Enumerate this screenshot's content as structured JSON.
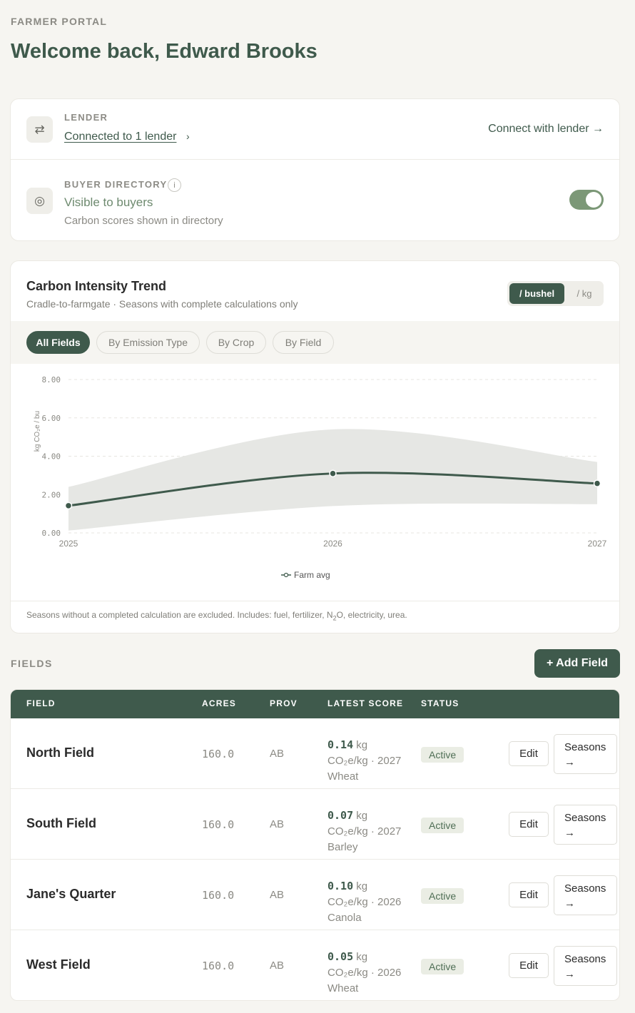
{
  "header": {
    "eyebrow": "FARMER PORTAL",
    "welcome": "Welcome back, Edward Brooks"
  },
  "lender": {
    "label": "LENDER",
    "link_text": "Connected to 1 lender",
    "chevron": "›",
    "action": "Connect with lender →",
    "icon": "swap-arrows-icon"
  },
  "buyer": {
    "label": "BUYER DIRECTORY",
    "info": "i",
    "status": "Visible to buyers",
    "sub": "Carbon scores shown in directory",
    "toggle_on": true,
    "icon": "target-icon"
  },
  "chart_card": {
    "title": "Carbon Intensity Trend",
    "subtitle": "Cradle-to-farmgate · Seasons with complete calculations only",
    "units": [
      "/ bushel",
      "/ kg"
    ],
    "selected_unit": "/ bushel",
    "filters": [
      "All Fields",
      "By Emission Type",
      "By Crop",
      "By Field"
    ],
    "selected_filter": "All Fields",
    "footnote_pre": "Seasons without a completed calculation are excluded. Includes: fuel, fertilizer, N",
    "footnote_sub": "2",
    "footnote_post": "O, electricity, urea."
  },
  "chart_data": {
    "type": "line",
    "x": [
      "2025",
      "2026",
      "2027"
    ],
    "series": [
      {
        "name": "Farm avg",
        "values": [
          1.42,
          3.1,
          2.58
        ],
        "color": "#3f5a4c"
      }
    ],
    "band": {
      "upper": [
        2.4,
        5.4,
        3.7
      ],
      "lower": [
        0.12,
        1.4,
        1.5
      ],
      "color": "#e6e7e4"
    },
    "ylabel": "kg CO₂e / bu",
    "ylim": [
      0,
      8
    ],
    "yticks": [
      "0.00",
      "2.00",
      "4.00",
      "6.00",
      "8.00"
    ],
    "grid": true,
    "legend": "bottom-center"
  },
  "fields": {
    "label": "FIELDS",
    "add_button": "+ Add Field",
    "columns": [
      "FIELD",
      "ACRES",
      "PROV",
      "LATEST SCORE",
      "STATUS"
    ],
    "rows": [
      {
        "name": "North Field",
        "acres": "160.0",
        "prov": "AB",
        "score": "0.14",
        "unit_line": "kg",
        "line2": "CO₂e/kg · 2027",
        "crop": "Wheat",
        "status": "Active",
        "edit": "Edit",
        "seasons": "Seasons",
        "seasons_arrow": "→"
      },
      {
        "name": "South Field",
        "acres": "160.0",
        "prov": "AB",
        "score": "0.07",
        "unit_line": "kg",
        "line2": "CO₂e/kg · 2027",
        "crop": "Barley",
        "status": "Active",
        "edit": "Edit",
        "seasons": "Seasons",
        "seasons_arrow": "→"
      },
      {
        "name": "Jane's Quarter",
        "acres": "160.0",
        "prov": "AB",
        "score": "0.10",
        "unit_line": "kg",
        "line2": "CO₂e/kg · 2026",
        "crop": "Canola",
        "status": "Active",
        "edit": "Edit",
        "seasons": "Seasons",
        "seasons_arrow": "→"
      },
      {
        "name": "West Field",
        "acres": "160.0",
        "prov": "AB",
        "score": "0.05",
        "unit_line": "kg",
        "line2": "CO₂e/kg · 2026",
        "crop": "Wheat",
        "status": "Active",
        "edit": "Edit",
        "seasons": "Seasons",
        "seasons_arrow": "→"
      }
    ]
  },
  "colors": {
    "brand": "#3f5a4c",
    "accent_green": "#7c9877",
    "background": "#f6f5f1"
  }
}
